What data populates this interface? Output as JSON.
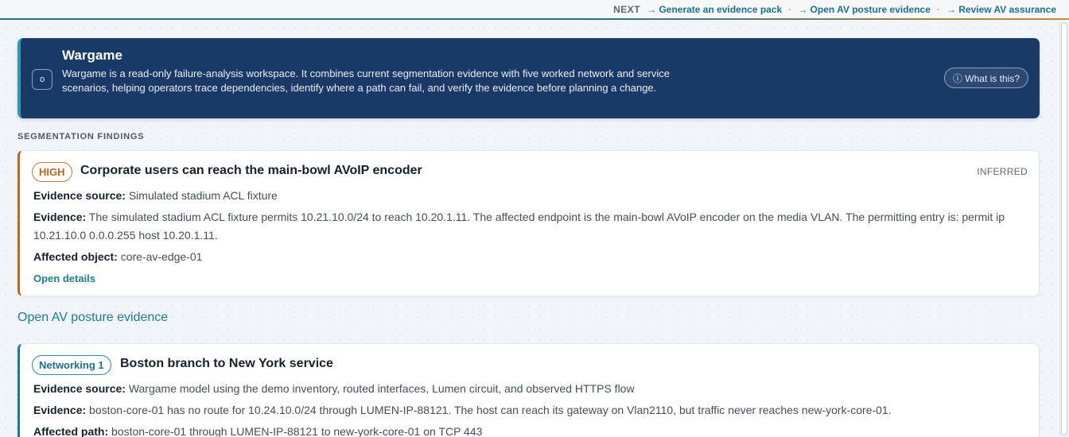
{
  "topbar": {
    "next_label": "NEXT",
    "links": [
      "→ Generate an evidence pack",
      "→ Open AV posture evidence",
      "→ Review AV assurance"
    ],
    "separator": "·"
  },
  "banner": {
    "icon": "circle-icon",
    "icon_glyph": "o",
    "title": "Wargame",
    "text": "Wargame is a read-only failure-analysis workspace. It combines current segmentation evidence with five worked network and service scenarios, helping operators trace dependencies, identify where a path can fail, and verify the evidence before planning a change.",
    "help_button": "ⓘ What is this?"
  },
  "section": {
    "label": "SEGMENTATION FINDINGS"
  },
  "finding": {
    "severity": "HIGH",
    "title": "Corporate users can reach the main-bowl AVoIP encoder",
    "status": "INFERRED",
    "source_label": "Evidence source:",
    "source_value": "Simulated stadium ACL fixture",
    "evidence_label": "Evidence:",
    "evidence_value": "The simulated stadium ACL fixture permits 10.21.10.0/24 to reach 10.20.1.11. The affected endpoint is the main-bowl AVoIP encoder on the media VLAN. The permitting entry is: permit ip 10.21.10.0 0.0.0.255 host 10.20.1.11.",
    "object_label": "Affected object:",
    "object_value": "core-av-edge-01",
    "details_link": "Open details"
  },
  "mid_link": "Open AV posture evidence",
  "scenario": {
    "tag": "Networking 1",
    "title": "Boston branch to New York service",
    "source_label": "Evidence source:",
    "source_value": "Wargame model using the demo inventory, routed interfaces, Lumen circuit, and observed HTTPS flow",
    "evidence_label": "Evidence:",
    "evidence_value": "boston-core-01 has no route for 10.24.10.0/24 through LUMEN-IP-88121. The host can reach its gateway on Vlan2110, but traffic never reaches new-york-core-01.",
    "path_label": "Affected path:",
    "path_value": "boston-core-01 through LUMEN-IP-88121 to new-york-core-01 on TCP 443"
  },
  "colors": {
    "banner_bg": "#193a66",
    "accent_teal": "#1d7d92",
    "high_orange": "#bd6a1c"
  }
}
